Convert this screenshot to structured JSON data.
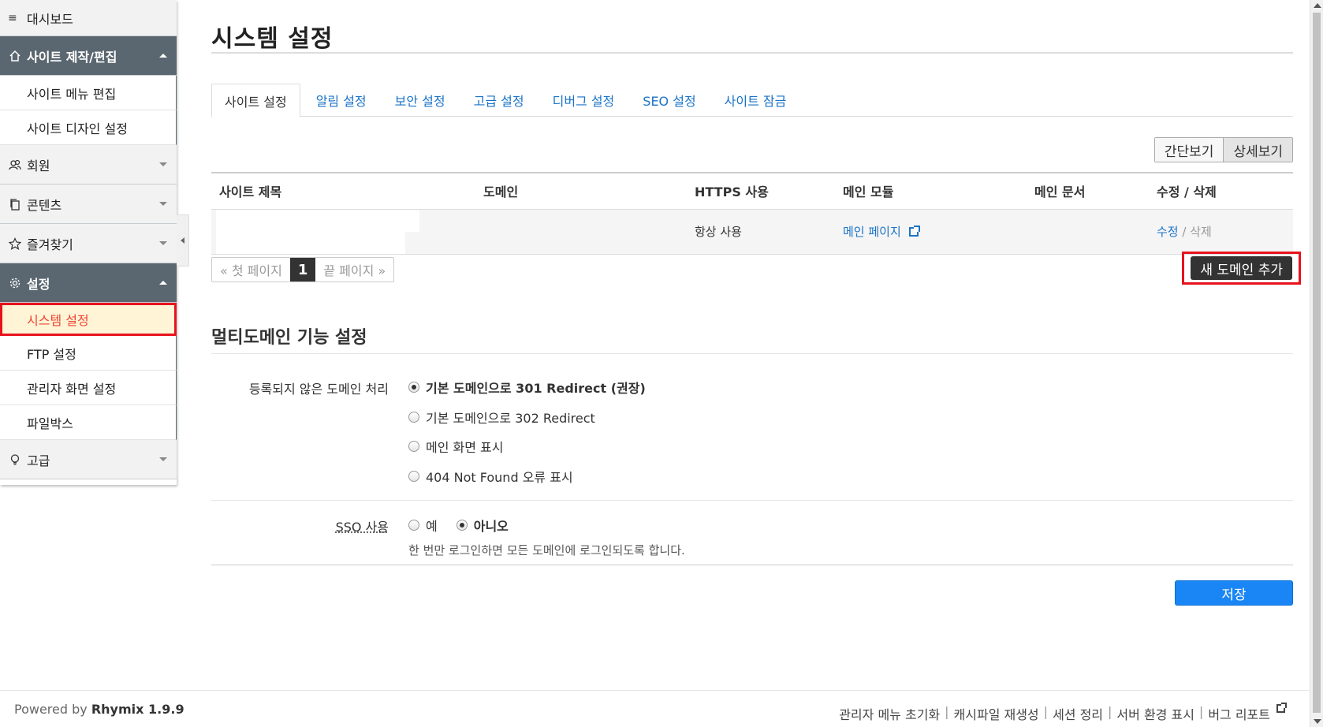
{
  "sidebar": {
    "dashboard": "대시보드",
    "groups": {
      "site": {
        "label": "사이트 제작/편집",
        "items": [
          "사이트 메뉴 편집",
          "사이트 디자인 설정"
        ]
      },
      "member": {
        "label": "회원"
      },
      "content": {
        "label": "콘텐츠"
      },
      "favorites": {
        "label": "즐겨찾기"
      },
      "settings": {
        "label": "설정",
        "items": [
          "시스템 설정",
          "FTP 설정",
          "관리자 화면 설정",
          "파일박스"
        ]
      },
      "advanced": {
        "label": "고급"
      }
    }
  },
  "main": {
    "title": "시스템 설정",
    "tabs": [
      "사이트 설정",
      "알림 설정",
      "보안 설정",
      "고급 설정",
      "디버그 설정",
      "SEO 설정",
      "사이트 잠금"
    ],
    "view_toggle": [
      "간단보기",
      "상세보기"
    ],
    "table": {
      "headers": [
        "사이트 제목",
        "도메인",
        "HTTPS 사용",
        "메인 모듈",
        "메인 문서",
        "수정 / 삭제"
      ],
      "rows": [
        {
          "site_title": "",
          "domain": "",
          "https": "항상 사용",
          "main_module": "메인 페이지",
          "main_doc": "",
          "edit": "수정",
          "slash": "/",
          "delete": "삭제"
        }
      ]
    },
    "pager": {
      "first": "« 첫 페이지",
      "current": "1",
      "last": "끝 페이지 »"
    },
    "add_domain": "새 도메인 추가",
    "multidomain": {
      "title": "멀티도메인 기능 설정",
      "unregistered_label": "등록되지 않은 도메인 처리",
      "options": [
        "기본 도메인으로 301 Redirect (권장)",
        "기본 도메인으로 302 Redirect",
        "메인 화면 표시",
        "404 Not Found 오류 표시"
      ],
      "selected_option": 0,
      "sso_label": "SSO 사용",
      "sso_options": [
        "예",
        "아니오"
      ],
      "sso_selected": 1,
      "sso_help": "한 번만 로그인하면 모든 도메인에 로그인되도록 합니다."
    },
    "save": "저장"
  },
  "footer": {
    "powered_prefix": "Powered by",
    "powered_brand": "Rhymix 1.9.9",
    "links": [
      "관리자 메뉴 초기화",
      "캐시파일 재생성",
      "세션 정리",
      "서버 환경 표시",
      "버그 리포트"
    ],
    "separator": "|"
  },
  "colors": {
    "accent": "#1a73c8",
    "highlight_border": "#e8121c",
    "sidebar_open": "#5b6770",
    "save_button": "#1a86f5"
  },
  "icons": [
    "menu-icon",
    "home-icon",
    "users-icon",
    "copy-icon",
    "star-icon",
    "gear-icon",
    "bulb-icon",
    "external-link-icon"
  ]
}
